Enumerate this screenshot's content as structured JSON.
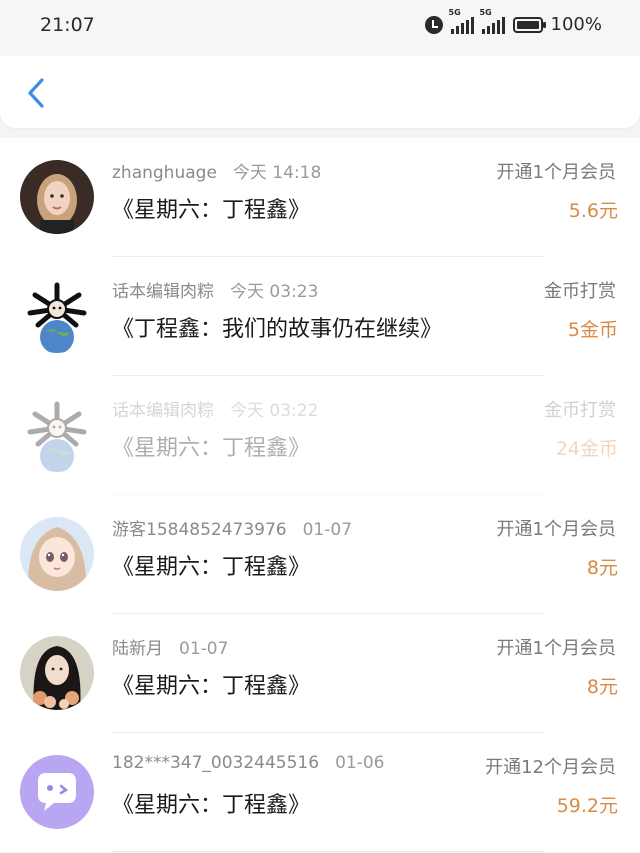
{
  "status_bar": {
    "time": "21:07",
    "signal_label": "5G",
    "battery": "100%"
  },
  "records": [
    {
      "user": "zhanghuage",
      "time": "今天 14:18",
      "title": "《星期六：丁程鑫》",
      "type": "开通1个月会员",
      "amount": "5.6元",
      "avatar": "girl-portrait",
      "faded": false
    },
    {
      "user": "话本编辑肉粽",
      "time": "今天 03:23",
      "title": "《丁程鑫：我们的故事仍在继续》",
      "type": "金币打赏",
      "amount": "5金币",
      "avatar": "earth-mascot",
      "faded": false
    },
    {
      "user": "话本编辑肉粽",
      "time": "今天 03:22",
      "title": "《星期六：丁程鑫》",
      "type": "金币打赏",
      "amount": "24金币",
      "avatar": "earth-mascot",
      "faded": true
    },
    {
      "user": "游客1584852473976",
      "time": "01-07",
      "title": "《星期六：丁程鑫》",
      "type": "开通1个月会员",
      "amount": "8元",
      "avatar": "anime-girl",
      "faded": false
    },
    {
      "user": "陆新月",
      "time": "01-07",
      "title": "《星期六：丁程鑫》",
      "type": "开通1个月会员",
      "amount": "8元",
      "avatar": "girl-flowers",
      "faded": false
    },
    {
      "user": "182***347_0032445516",
      "time": "01-06",
      "title": "《星期六：丁程鑫》",
      "type": "开通12个月会员",
      "amount": "59.2元",
      "avatar": "chat-bubble",
      "faded": false
    }
  ],
  "colors": {
    "accent_back": "#3b8ee6",
    "amount": "#d98b45"
  }
}
